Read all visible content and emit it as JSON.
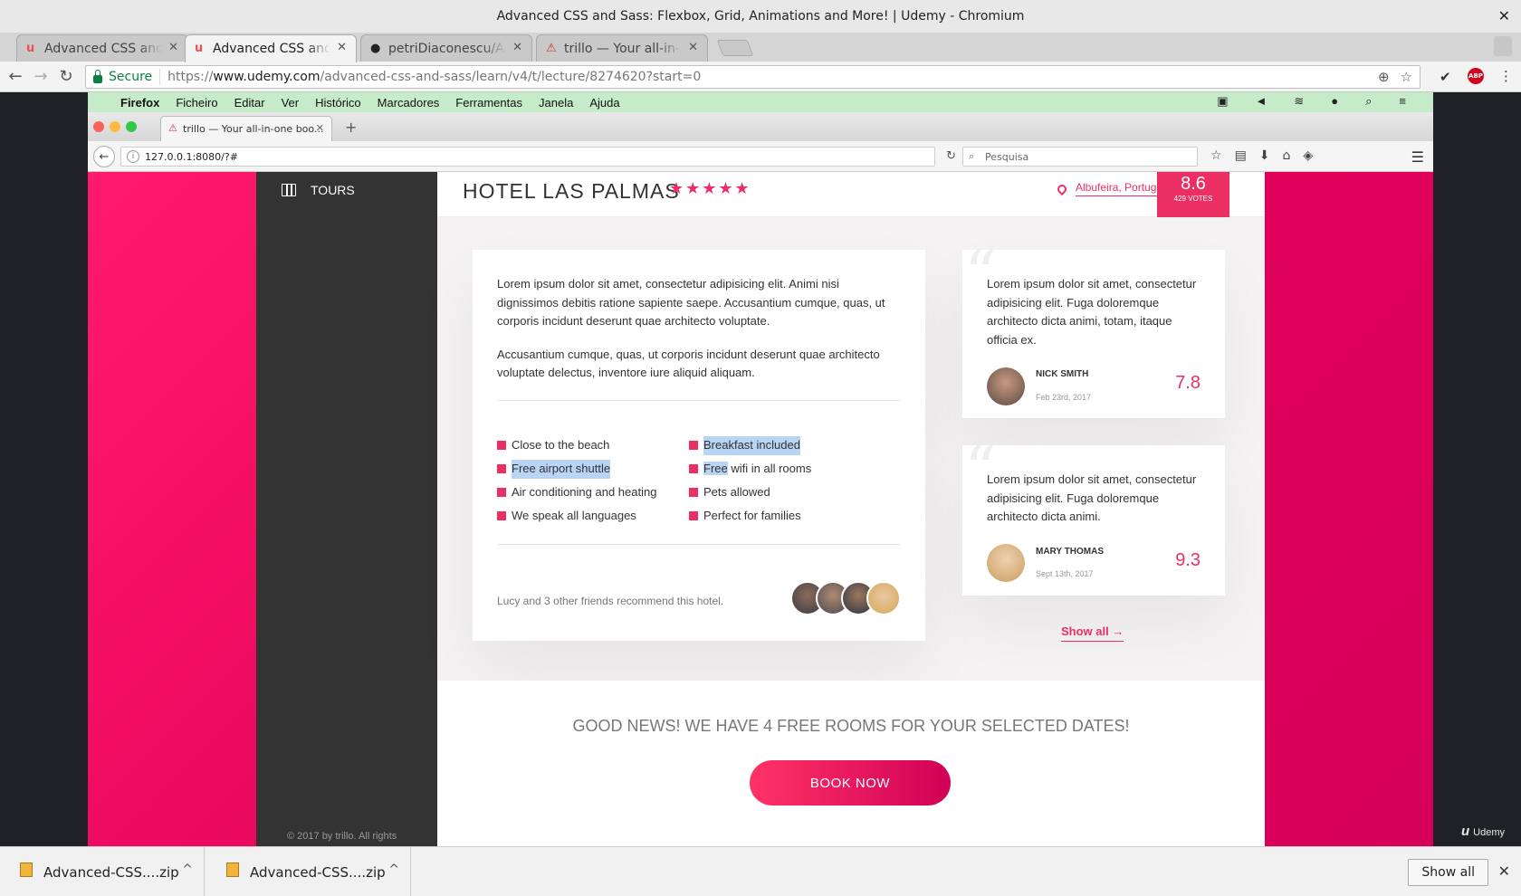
{
  "window": {
    "title": "Advanced CSS and Sass: Flexbox, Grid, Animations and More! | Udemy - Chromium",
    "close_glyph": "✕"
  },
  "tabs": [
    {
      "title": "Advanced CSS and S",
      "icon": "udemy-icon",
      "icon_glyph": "u"
    },
    {
      "title": "Advanced CSS and S",
      "icon": "udemy-icon",
      "icon_glyph": "u"
    },
    {
      "title": "petriDiaconescu/Adv",
      "icon": "github-icon",
      "icon_glyph": "●"
    },
    {
      "title": "trillo — Your all-in-o",
      "icon": "warning-icon",
      "icon_glyph": "⚠"
    }
  ],
  "tab_close_glyph": "✕",
  "toolbar": {
    "back": "←",
    "forward": "→",
    "reload": "↻",
    "secure_label": "Secure",
    "url_prefix": "https://",
    "url_host": "www.udemy.com",
    "url_path": "/advanced-css-and-sass/learn/v4/t/lecture/8274620?start=0",
    "abp_label": "ABP"
  },
  "mac_menubar": {
    "apple": "",
    "items": [
      "Firefox",
      "Ficheiro",
      "Editar",
      "Ver",
      "Histórico",
      "Marcadores",
      "Ferramentas",
      "Janela",
      "Ajuda"
    ]
  },
  "firefox": {
    "tab_title": "trillo — Your all-in-one boo...",
    "url": "127.0.0.1:8080/?#",
    "search_placeholder": "Pesquisa"
  },
  "trillo": {
    "sidebar": {
      "item_label": "TOURS",
      "legal": "© 2017 by trillo. All rights"
    },
    "hotel": {
      "name": "HOTEL LAS PALMAS",
      "stars": "★★★★★",
      "location": "Albufeira, Portugal",
      "rating": "8.6",
      "votes": "429 VOTES"
    },
    "description": {
      "para1": "Lorem ipsum dolor sit amet, consectetur adipisicing elit. Animi nisi dignissimos debitis ratione sapiente saepe. Accusantium cumque, quas, ut corporis incidunt deserunt quae architecto voluptate.",
      "para2": "Accusantium cumque, quas, ut corporis incidunt deserunt quae architecto voluptate delectus, inventore iure aliquid aliquam.",
      "features": [
        "Close to the beach",
        "Free airport shuttle",
        "Air conditioning and heating",
        "We speak all languages",
        "Breakfast included",
        "Free",
        " wifi in all rooms",
        "Pets allowed",
        "Perfect for families"
      ],
      "recommend": "Lucy and 3 other friends recommend this hotel."
    },
    "reviews": [
      {
        "text": "Lorem ipsum dolor sit amet, consectetur adipisicing elit. Fuga doloremque architecto dicta animi, totam, itaque officia ex.",
        "name": "Nick Smith",
        "date": "Feb 23rd, 2017",
        "rating": "7.8"
      },
      {
        "text": "Lorem ipsum dolor sit amet, consectetur adipisicing elit. Fuga doloremque architecto dicta animi.",
        "name": "Mary Thomas",
        "date": "Sept 13th, 2017",
        "rating": "9.3"
      }
    ],
    "show_all": "Show all →",
    "cta_text": "GOOD NEWS! WE HAVE 4 FREE ROOMS FOR YOUR SELECTED DATES!",
    "book_now": "BOOK NOW"
  },
  "udemy_watermark": {
    "logo": "u",
    "label": "Udemy"
  },
  "downloads": {
    "items": [
      "Advanced-CSS....zip",
      "Advanced-CSS....zip"
    ],
    "caret": "^",
    "show_all": "Show all",
    "close": "✕"
  },
  "colors": {
    "trillo_primary": "#eb2f64",
    "sidebar": "#333333",
    "mac_menubar": "#c6ebc9"
  }
}
